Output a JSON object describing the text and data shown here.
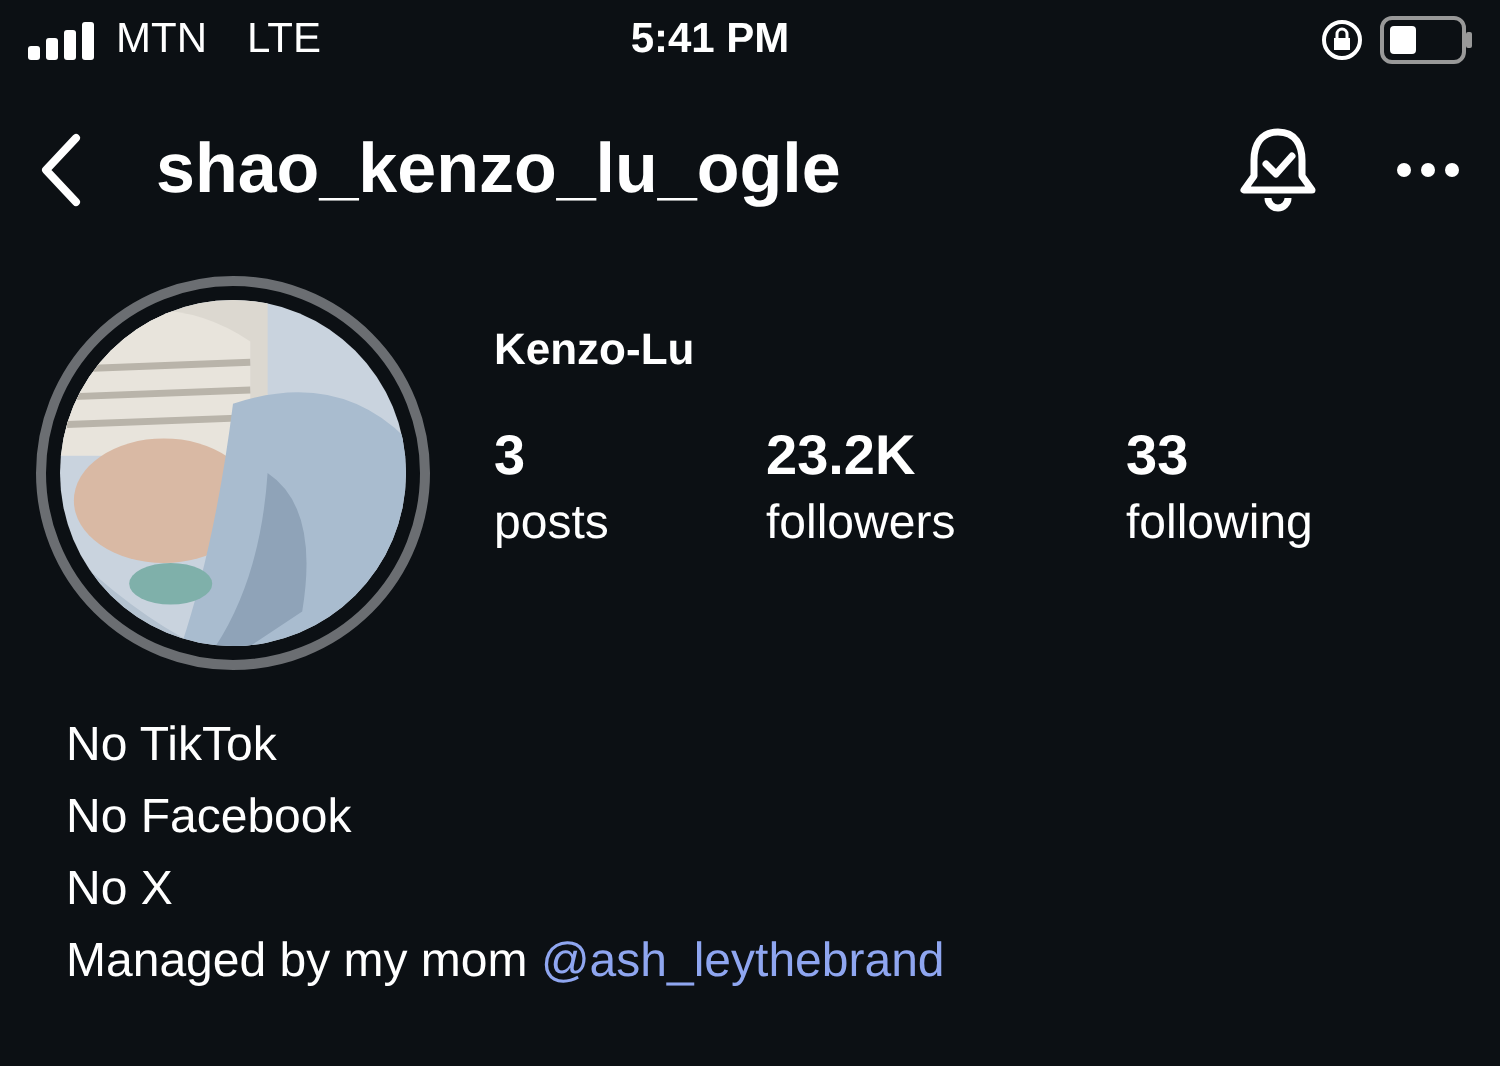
{
  "status_bar": {
    "carrier": "MTN",
    "network": "LTE",
    "time": "5:41 PM"
  },
  "header": {
    "username": "shao_kenzo_lu_ogle"
  },
  "profile": {
    "display_name": "Kenzo-Lu",
    "stats": [
      {
        "value": "3",
        "label": "posts"
      },
      {
        "value": "23.2K",
        "label": "followers"
      },
      {
        "value": "33",
        "label": "following"
      }
    ]
  },
  "bio": {
    "lines": [
      "No TikTok",
      "No Facebook",
      "No X"
    ],
    "managed_text": "Managed by my mom",
    "managed_link": "@ash_leythebrand"
  }
}
